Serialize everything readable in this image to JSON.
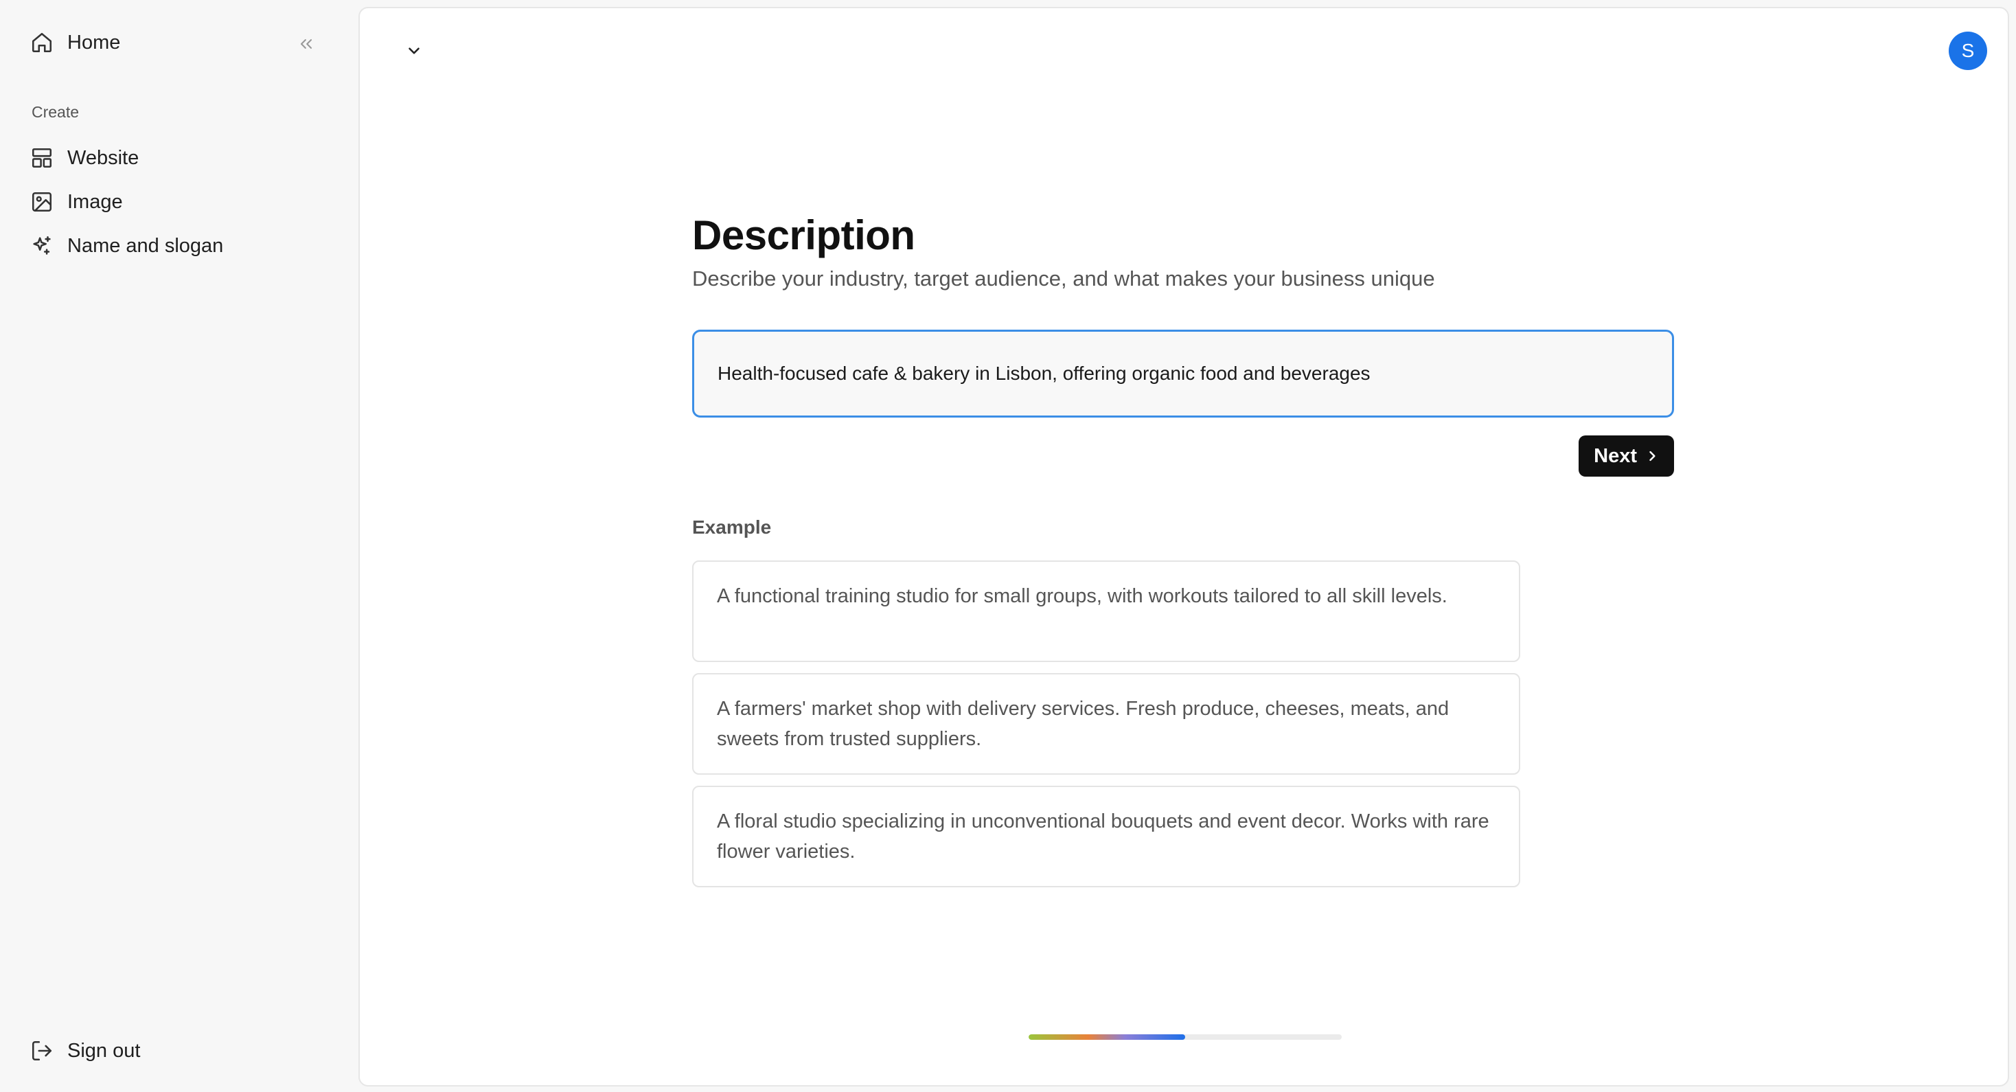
{
  "sidebar": {
    "home_label": "Home",
    "section_label": "Create",
    "items": [
      {
        "label": "Website",
        "icon": "layout-icon"
      },
      {
        "label": "Image",
        "icon": "image-icon"
      },
      {
        "label": "Name and slogan",
        "icon": "sparkles-icon"
      }
    ],
    "signout_label": "Sign out"
  },
  "header": {
    "avatar_initial": "S"
  },
  "main": {
    "title": "Description",
    "subtitle": "Describe your industry, target audience, and what makes your business unique",
    "input_value": "Health-focused cafe & bakery in Lisbon, offering organic food and beverages",
    "next_label": "Next",
    "example_label": "Example",
    "examples": [
      "A functional training studio for small groups, with workouts tailored to all skill levels.",
      "A farmers' market shop with delivery services. Fresh produce, cheeses, meats, and sweets from trusted suppliers.",
      "A floral studio specializing in unconventional bouquets and event decor. Works with rare flower varieties."
    ],
    "progress_fraction": 0.5
  },
  "colors": {
    "accent": "#1a73e8",
    "input_border": "#3b8ee6",
    "button_bg": "#111111"
  }
}
